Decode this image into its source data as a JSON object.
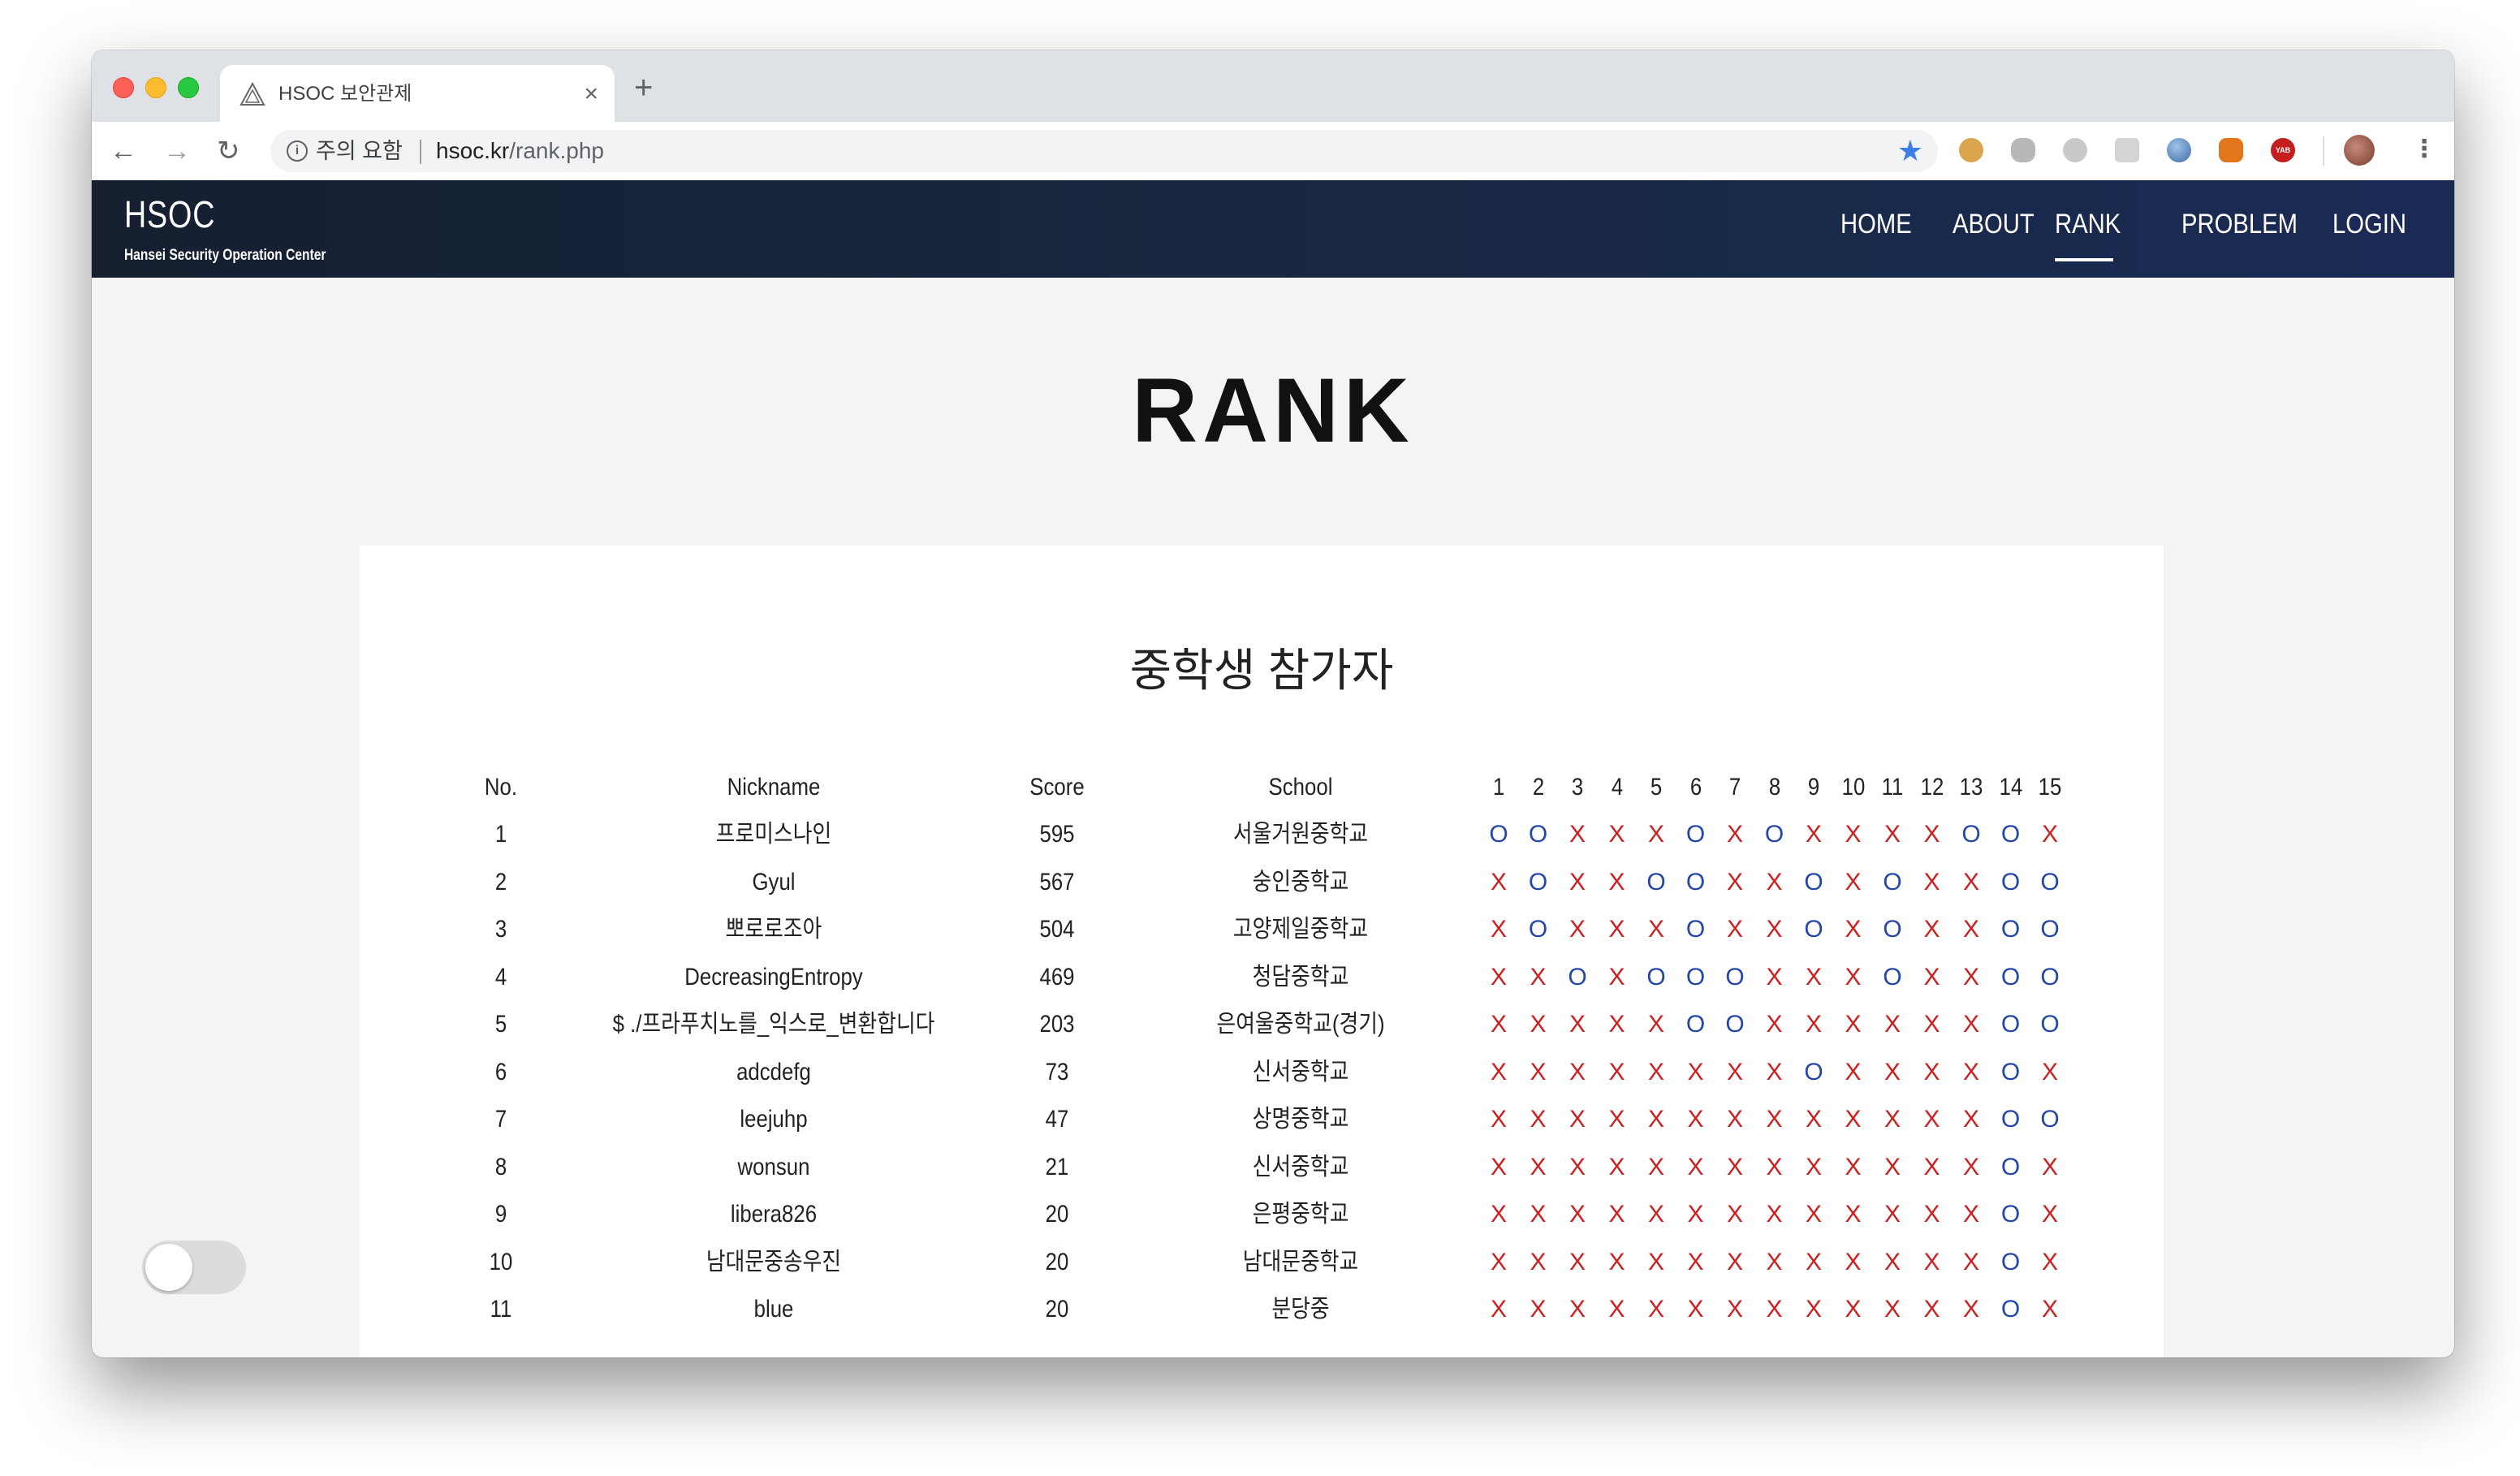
{
  "browser": {
    "tab_title": "HSOC 보안관제",
    "tab_close": "×",
    "new_tab": "+",
    "back": "←",
    "forward": "→",
    "reload": "↻",
    "security_text": "주의 요함",
    "url_host": "hsoc.kr",
    "url_path": "/rank.php",
    "bookmark_star": "★",
    "menu": "⋮"
  },
  "site": {
    "logo": "HSOC",
    "logo_sub": "Hansei Security Operation Center",
    "nav": [
      "HOME",
      "ABOUT",
      "RANK",
      "PROBLEM",
      "LOGIN"
    ],
    "active_nav": "RANK"
  },
  "page": {
    "title": "RANK",
    "section_title": "중학생 참가자"
  },
  "table": {
    "headers": {
      "no": "No.",
      "nickname": "Nickname",
      "score": "Score",
      "school": "School"
    },
    "problems": [
      "1",
      "2",
      "3",
      "4",
      "5",
      "6",
      "7",
      "8",
      "9",
      "10",
      "11",
      "12",
      "13",
      "14",
      "15"
    ],
    "rows": [
      {
        "no": "1",
        "nickname": "프로미스나인",
        "score": "595",
        "school": "서울거원중학교",
        "results": [
          "O",
          "O",
          "X",
          "X",
          "X",
          "O",
          "X",
          "O",
          "X",
          "X",
          "X",
          "X",
          "O",
          "O",
          "X"
        ]
      },
      {
        "no": "2",
        "nickname": "Gyul",
        "score": "567",
        "school": "숭인중학교",
        "results": [
          "X",
          "O",
          "X",
          "X",
          "O",
          "O",
          "X",
          "X",
          "O",
          "X",
          "O",
          "X",
          "X",
          "O",
          "O"
        ]
      },
      {
        "no": "3",
        "nickname": "뽀로로조아",
        "score": "504",
        "school": "고양제일중학교",
        "results": [
          "X",
          "O",
          "X",
          "X",
          "X",
          "O",
          "X",
          "X",
          "O",
          "X",
          "O",
          "X",
          "X",
          "O",
          "O"
        ]
      },
      {
        "no": "4",
        "nickname": "DecreasingEntropy",
        "score": "469",
        "school": "청담중학교",
        "results": [
          "X",
          "X",
          "O",
          "X",
          "O",
          "O",
          "O",
          "X",
          "X",
          "X",
          "O",
          "X",
          "X",
          "O",
          "O"
        ]
      },
      {
        "no": "5",
        "nickname": "$ ./프라푸치노를_익스로_변환합니다",
        "score": "203",
        "school": "은여울중학교(경기)",
        "results": [
          "X",
          "X",
          "X",
          "X",
          "X",
          "O",
          "O",
          "X",
          "X",
          "X",
          "X",
          "X",
          "X",
          "O",
          "O"
        ]
      },
      {
        "no": "6",
        "nickname": "adcdefg",
        "score": "73",
        "school": "신서중학교",
        "results": [
          "X",
          "X",
          "X",
          "X",
          "X",
          "X",
          "X",
          "X",
          "O",
          "X",
          "X",
          "X",
          "X",
          "O",
          "X"
        ]
      },
      {
        "no": "7",
        "nickname": "leejuhp",
        "score": "47",
        "school": "상명중학교",
        "results": [
          "X",
          "X",
          "X",
          "X",
          "X",
          "X",
          "X",
          "X",
          "X",
          "X",
          "X",
          "X",
          "X",
          "O",
          "O"
        ]
      },
      {
        "no": "8",
        "nickname": "wonsun",
        "score": "21",
        "school": "신서중학교",
        "results": [
          "X",
          "X",
          "X",
          "X",
          "X",
          "X",
          "X",
          "X",
          "X",
          "X",
          "X",
          "X",
          "X",
          "O",
          "X"
        ]
      },
      {
        "no": "9",
        "nickname": "libera826",
        "score": "20",
        "school": "은평중학교",
        "results": [
          "X",
          "X",
          "X",
          "X",
          "X",
          "X",
          "X",
          "X",
          "X",
          "X",
          "X",
          "X",
          "X",
          "O",
          "X"
        ]
      },
      {
        "no": "10",
        "nickname": "남대문중송우진",
        "score": "20",
        "school": "남대문중학교",
        "results": [
          "X",
          "X",
          "X",
          "X",
          "X",
          "X",
          "X",
          "X",
          "X",
          "X",
          "X",
          "X",
          "X",
          "O",
          "X"
        ]
      },
      {
        "no": "11",
        "nickname": "blue",
        "score": "20",
        "school": "분당중",
        "results": [
          "X",
          "X",
          "X",
          "X",
          "X",
          "X",
          "X",
          "X",
          "X",
          "X",
          "X",
          "X",
          "X",
          "O",
          "X"
        ]
      }
    ]
  },
  "colors": {
    "header_bg": "#172338",
    "solved": "#2547a8",
    "unsolved": "#cc2020",
    "bookmark": "#3d7fe8"
  },
  "extensions": [
    "cookie-icon",
    "touch-icon",
    "chat-icon",
    "camera-icon",
    "globe-icon",
    "fox-icon",
    "yab-icon"
  ],
  "extension_yab_label": "YAB"
}
